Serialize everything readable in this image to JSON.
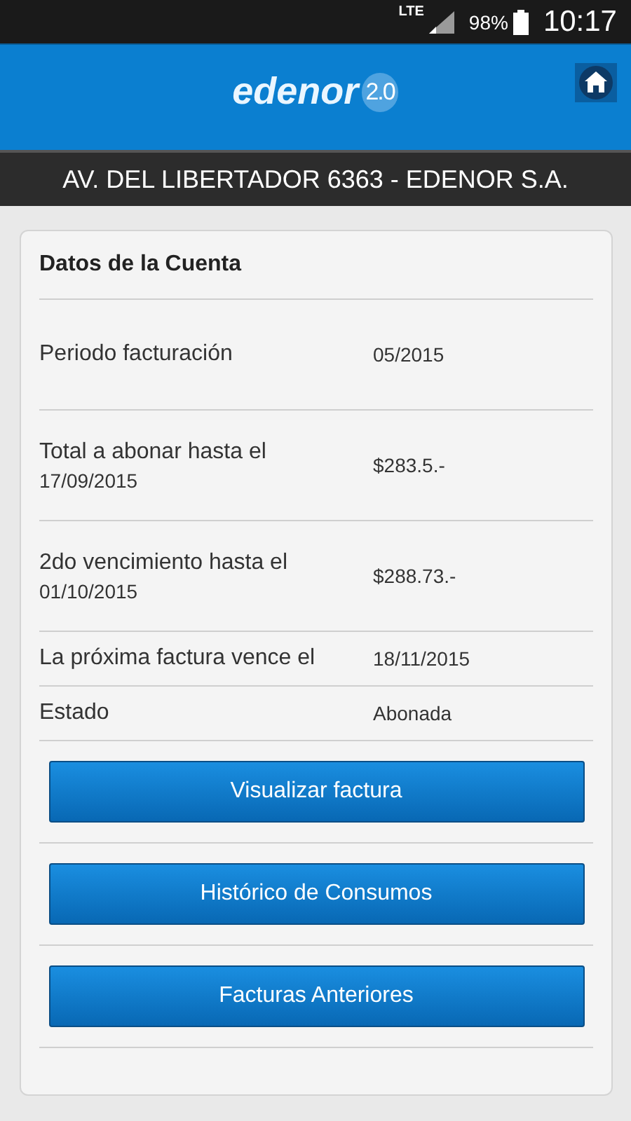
{
  "status_bar": {
    "network": "LTE",
    "battery": "98%",
    "time": "10:17"
  },
  "header": {
    "logo_text": "edenor",
    "logo_version": "2.0"
  },
  "address": "AV. DEL LIBERTADOR 6363 - EDENOR S.A.",
  "card": {
    "title": "Datos de la Cuenta",
    "rows": [
      {
        "label": "Periodo facturación",
        "value": "05/2015",
        "kind": "tall"
      },
      {
        "label": "Total a abonar hasta el",
        "sublabel": "17/09/2015",
        "value": "$283.5.-",
        "kind": "tall"
      },
      {
        "label": "2do vencimiento hasta el",
        "sublabel": "01/10/2015",
        "value": "$288.73.-",
        "kind": "tall"
      },
      {
        "label": "La próxima factura vence el",
        "value": "18/11/2015",
        "kind": "short"
      },
      {
        "label": "Estado",
        "value": "Abonada",
        "kind": "short"
      }
    ],
    "buttons": [
      "Visualizar factura",
      "Histórico de Consumos",
      "Facturas Anteriores"
    ]
  }
}
